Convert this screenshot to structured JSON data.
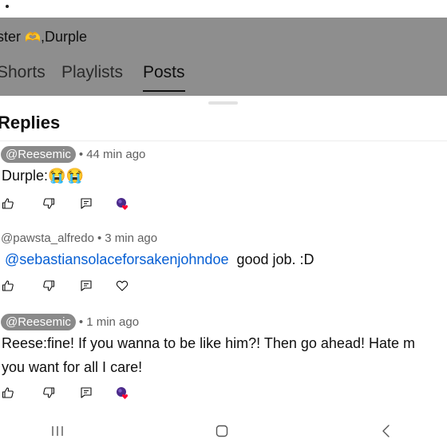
{
  "header": {
    "channel_name_prefix": "ster ",
    "channel_name_emoji": "🫶",
    "channel_name_suffix": ",Durple",
    "tabs": [
      "Shorts",
      "Playlists",
      "Posts"
    ]
  },
  "replies": {
    "title": "Replies",
    "comments": [
      {
        "handle": "@Reesemic",
        "time": "44 min ago",
        "text": "Durple:😭😭",
        "has_creator_heart": true
      },
      {
        "handle": "@pawsta_alfredo",
        "time": "3 min ago",
        "mention": "@sebastiansolaceforsakenjohndoe",
        "text": "good job. :D",
        "has_creator_heart": false
      },
      {
        "handle": "@Reesemic",
        "time": "1 min ago",
        "text_line1": "Reese:fine! If you wanna to be like him?! Then go ahead! Hate m",
        "text_line2": "you want for all I care!",
        "has_creator_heart": true
      }
    ]
  },
  "icons": {
    "like": "thumbs-up-icon",
    "dislike": "thumbs-down-icon",
    "reply": "reply-icon",
    "heart": "heart-icon",
    "creator_heart": "creator-heart-icon"
  },
  "colors": {
    "mention": "#065fd4",
    "handle_chip": "#8a8a8a",
    "creator_heart": "#ff0033"
  },
  "system_nav": [
    "recent-apps-icon",
    "home-icon",
    "back-icon"
  ]
}
